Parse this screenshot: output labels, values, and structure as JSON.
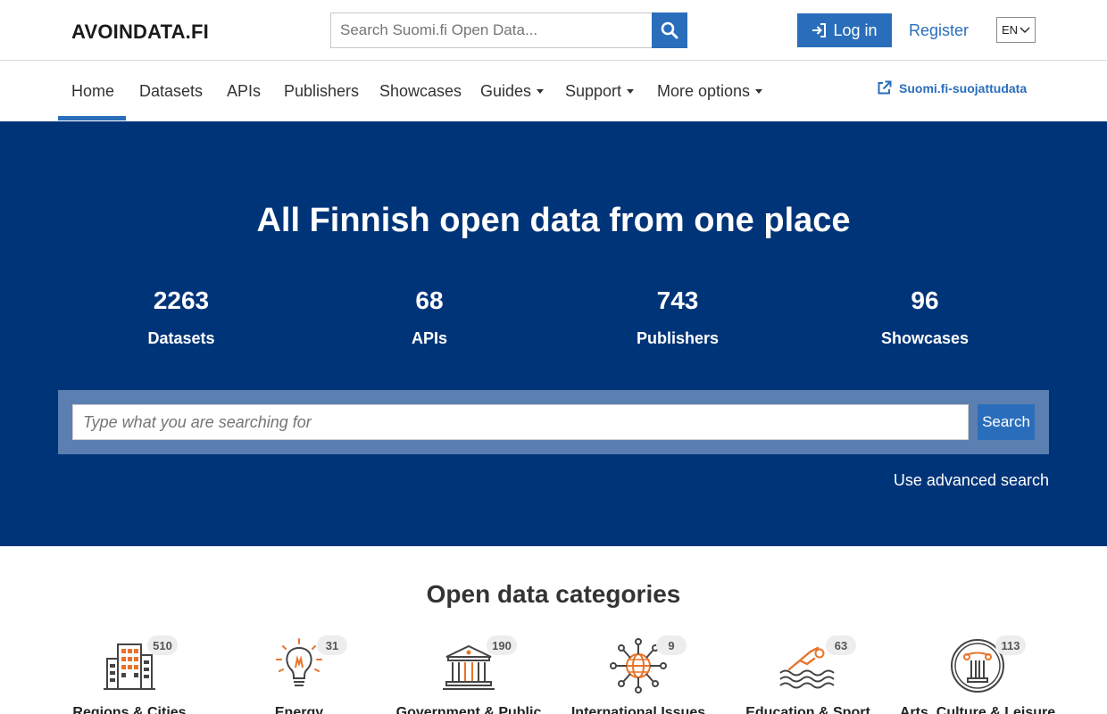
{
  "header": {
    "logo": "AVOINDATA.FI",
    "search_placeholder": "Search Suomi.fi Open Data...",
    "login_label": "Log in",
    "register_label": "Register",
    "language": "EN"
  },
  "nav": {
    "items": [
      {
        "label": "Home",
        "active": true
      },
      {
        "label": "Datasets"
      },
      {
        "label": "APIs"
      },
      {
        "label": "Publishers"
      },
      {
        "label": "Showcases"
      },
      {
        "label": "Guides",
        "dropdown": true
      },
      {
        "label": "Support",
        "dropdown": true
      },
      {
        "label": "More options",
        "dropdown": true
      }
    ],
    "external_link": "Suomi.fi-suojattudata"
  },
  "hero": {
    "title": "All Finnish open data from one place",
    "stats": [
      {
        "value": "2263",
        "label": "Datasets"
      },
      {
        "value": "68",
        "label": "APIs"
      },
      {
        "value": "743",
        "label": "Publishers"
      },
      {
        "value": "96",
        "label": "Showcases"
      }
    ],
    "search_placeholder": "Type what you are searching for",
    "search_button": "Search",
    "advanced_search": "Use advanced search"
  },
  "categories": {
    "title": "Open data categories",
    "items": [
      {
        "label": "Regions & Cities",
        "count": "510",
        "icon": "buildings-icon"
      },
      {
        "label": "Energy",
        "count": "31",
        "icon": "lightbulb-icon"
      },
      {
        "label": "Government & Public",
        "count": "190",
        "icon": "government-building-icon"
      },
      {
        "label": "International Issues",
        "count": "9",
        "icon": "globe-network-icon"
      },
      {
        "label": "Education & Sport",
        "count": "63",
        "icon": "swimmer-icon"
      },
      {
        "label": "Arts, Culture & Leisure",
        "count": "113",
        "icon": "column-icon"
      }
    ]
  },
  "colors": {
    "brand_blue": "#2a6ebb",
    "hero_bg": "#003479",
    "accent_orange": "#e8742a"
  }
}
